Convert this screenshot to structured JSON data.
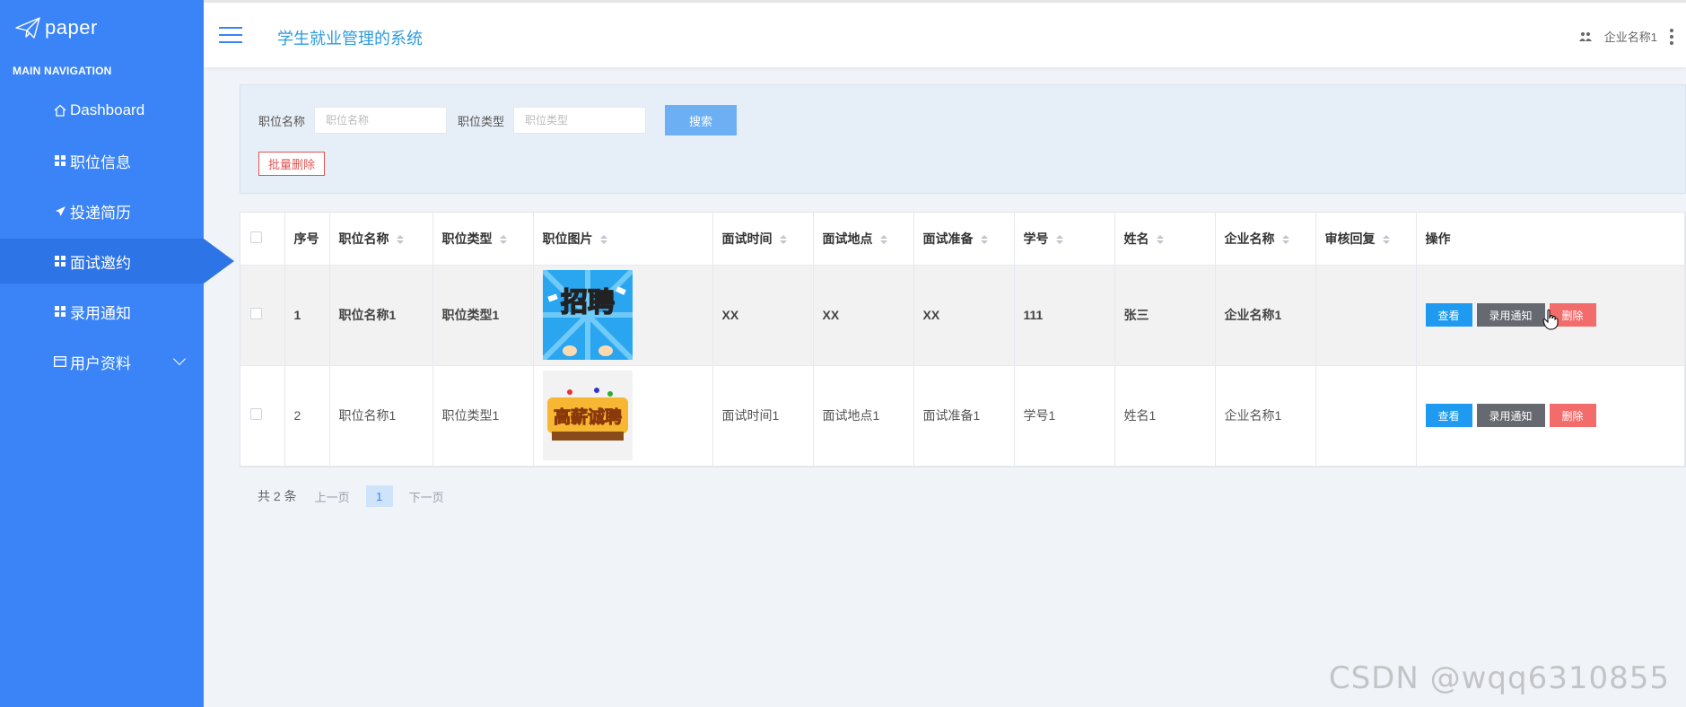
{
  "app": {
    "logo_text": "paper",
    "system_title": "学生就业管理的系统",
    "user_name": "企业名称1"
  },
  "sidebar": {
    "section_title": "MAIN NAVIGATION",
    "items": [
      {
        "label": "Dashboard",
        "icon": "home-icon"
      },
      {
        "label": "职位信息",
        "icon": "grid-icon"
      },
      {
        "label": "投递简历",
        "icon": "send-icon"
      },
      {
        "label": "面试邀约",
        "icon": "grid-icon",
        "active": true
      },
      {
        "label": "录用通知",
        "icon": "grid-icon"
      },
      {
        "label": "用户资料",
        "icon": "card-icon",
        "expandable": true
      }
    ]
  },
  "search": {
    "field1_label": "职位名称",
    "field1_placeholder": "职位名称",
    "field2_label": "职位类型",
    "field2_placeholder": "职位类型",
    "search_button": "搜索",
    "batch_delete_button": "批量删除"
  },
  "table": {
    "headers": [
      "序号",
      "职位名称",
      "职位类型",
      "职位图片",
      "面试时间",
      "面试地点",
      "面试准备",
      "学号",
      "姓名",
      "企业名称",
      "审核回复",
      "操作"
    ],
    "rows": [
      {
        "index": "1",
        "job_name": "职位名称1",
        "job_type": "职位类型1",
        "image": "招聘",
        "time": "XX",
        "place": "XX",
        "prep": "XX",
        "student_no": "111",
        "name": "张三",
        "company": "企业名称1",
        "reply": ""
      },
      {
        "index": "2",
        "job_name": "职位名称1",
        "job_type": "职位类型1",
        "image": "高薪诚聘",
        "time": "面试时间1",
        "place": "面试地点1",
        "prep": "面试准备1",
        "student_no": "学号1",
        "name": "姓名1",
        "company": "企业名称1",
        "reply": ""
      }
    ],
    "actions": {
      "view": "查看",
      "notify": "录用通知",
      "delete": "删除"
    }
  },
  "pagination": {
    "total": "共 2 条",
    "prev": "上一页",
    "current": "1",
    "next": "下一页"
  },
  "watermark": "CSDN @wqq6310855",
  "colors": {
    "sidebar": "#3a84f7",
    "view_button": "#1e9bf0",
    "notify_button": "#666a70",
    "delete_button": "#f36c6c",
    "title": "#2d9bdb"
  }
}
